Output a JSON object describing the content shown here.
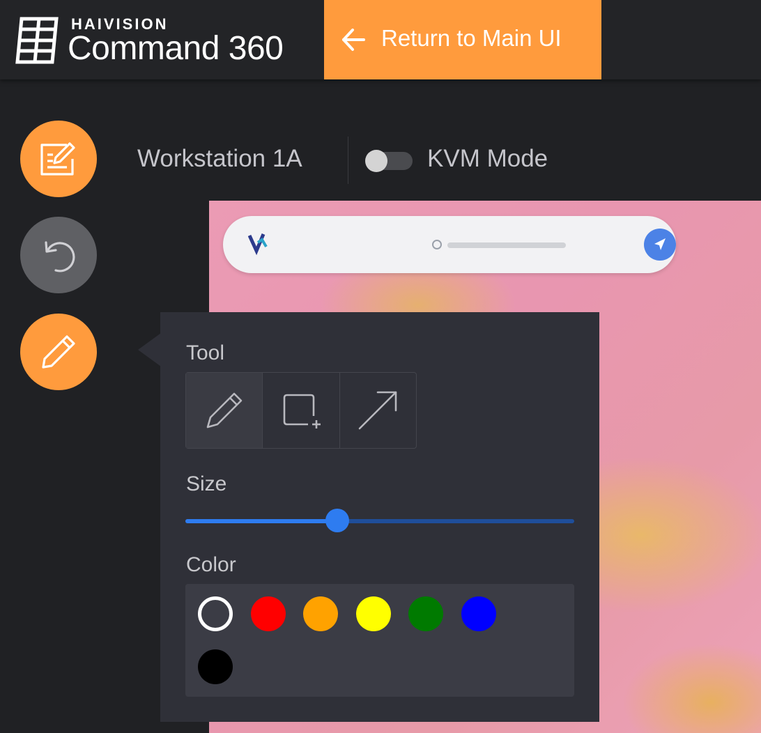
{
  "header": {
    "brand_company": "HAIVISION",
    "brand_product": "Command 360",
    "return_label": "Return to Main UI",
    "accent_color": "#ff9b3d"
  },
  "toolbar": {
    "icons": [
      "edit-board-icon",
      "undo-icon",
      "pencil-icon"
    ]
  },
  "workstation": {
    "name": "Workstation 1A",
    "kvm_label": "KVM Mode",
    "kvm_enabled": false
  },
  "annotation_panel": {
    "tool_label": "Tool",
    "tools": [
      "pencil-icon",
      "rectangle-add-icon",
      "arrow-icon"
    ],
    "selected_tool": 0,
    "size_label": "Size",
    "size_value": 0.39,
    "color_label": "Color",
    "colors": [
      "#ffffff",
      "#ff0000",
      "#ffa200",
      "#ffff00",
      "#007a00",
      "#0000ff",
      "#000000"
    ],
    "selected_color": 0
  }
}
